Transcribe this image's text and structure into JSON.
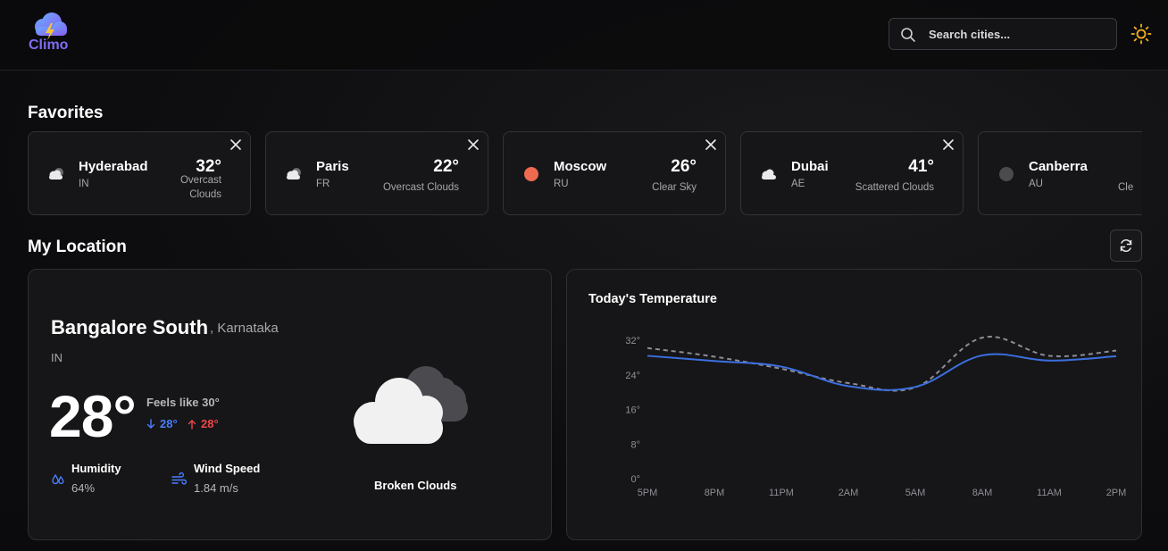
{
  "app": {
    "logo_text": "Climo"
  },
  "header": {
    "search": {
      "placeholder": "Search cities..."
    },
    "theme_icon": "sun-icon"
  },
  "favorites": {
    "title": "Favorites",
    "cards": [
      {
        "city": "Hyderabad",
        "country": "IN",
        "temp": "32°",
        "desc": "Overcast Clouds",
        "icon": "cloud-icon"
      },
      {
        "city": "Paris",
        "country": "FR",
        "temp": "22°",
        "desc": "Overcast Clouds",
        "icon": "cloud-icon"
      },
      {
        "city": "Moscow",
        "country": "RU",
        "temp": "26°",
        "desc": "Clear Sky",
        "icon": "sun-dot-icon"
      },
      {
        "city": "Dubai",
        "country": "AE",
        "temp": "41°",
        "desc": "Scattered Clouds",
        "icon": "cloud-icon"
      },
      {
        "city": "Canberra",
        "country": "AU",
        "temp": "",
        "desc": "Cle",
        "icon": "moon-dot-icon"
      }
    ]
  },
  "my_location": {
    "title": "My Location",
    "city": "Bangalore South",
    "region": ", Karnataka",
    "country": "IN",
    "temp": "28°",
    "feels_like": "Feels like 30°",
    "min": "28°",
    "max": "28°",
    "humidity_label": "Humidity",
    "humidity_value": "64%",
    "wind_label": "Wind Speed",
    "wind_value": "1.84 m/s",
    "condition": "Broken Clouds"
  },
  "chart": {
    "title": "Today's Temperature"
  },
  "chart_data": {
    "type": "line",
    "title": "Today's Temperature",
    "x": [
      "5PM",
      "8PM",
      "11PM",
      "2AM",
      "5AM",
      "8AM",
      "11AM",
      "2PM"
    ],
    "ylim": [
      0,
      32
    ],
    "yticks": [
      "0°",
      "8°",
      "16°",
      "24°",
      "32°"
    ],
    "series": [
      {
        "values": [
          28.4,
          27.2,
          25.9,
          21.4,
          21.2,
          28.5,
          27.3,
          28.3
        ],
        "color": "#3b6fe0",
        "style": "solid"
      },
      {
        "values": [
          30.2,
          28.2,
          25.4,
          22.1,
          21.1,
          32.6,
          28.4,
          29.6
        ],
        "color": "#8c8c96",
        "style": "dashed"
      }
    ],
    "grid": false
  }
}
